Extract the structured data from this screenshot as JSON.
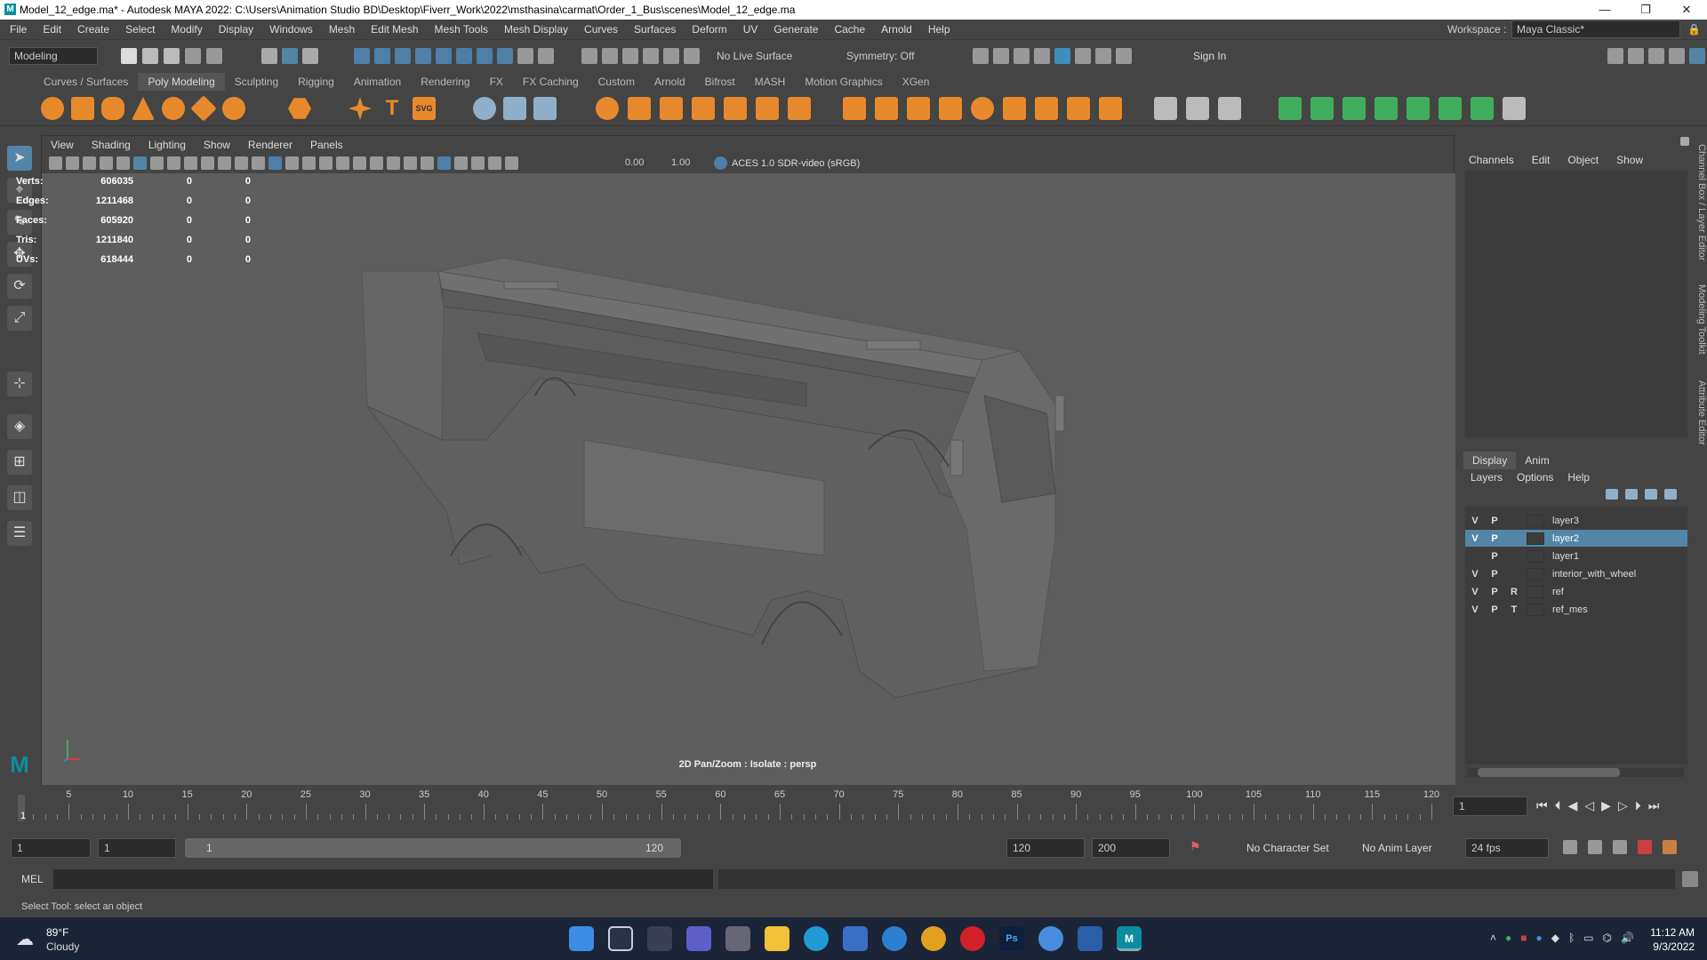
{
  "window": {
    "title": "Model_12_edge.ma* - Autodesk MAYA 2022: C:\\Users\\Animation Studio BD\\Desktop\\Fiverr_Work\\2022\\msthasina\\carmat\\Order_1_Bus\\scenes\\Model_12_edge.ma",
    "minimize": "—",
    "maximize": "❐",
    "close": "✕"
  },
  "menubar": {
    "items": [
      "File",
      "Edit",
      "Create",
      "Select",
      "Modify",
      "Display",
      "Windows",
      "Mesh",
      "Edit Mesh",
      "Mesh Tools",
      "Mesh Display",
      "Curves",
      "Surfaces",
      "Deform",
      "UV",
      "Generate",
      "Cache",
      "Arnold",
      "Help"
    ],
    "workspace_label": "Workspace :",
    "workspace_value": "Maya Classic*"
  },
  "statusline": {
    "menuset": "Modeling",
    "live_surface": "No Live Surface",
    "symmetry": "Symmetry: Off",
    "sign_in": "Sign In"
  },
  "shelf": {
    "tabs": [
      "Curves / Surfaces",
      "Poly Modeling",
      "Sculpting",
      "Rigging",
      "Animation",
      "Rendering",
      "FX",
      "FX Caching",
      "Custom",
      "Arnold",
      "Bifrost",
      "MASH",
      "Motion Graphics",
      "XGen"
    ],
    "active_tab": "Poly Modeling"
  },
  "viewport": {
    "menu": [
      "View",
      "Shading",
      "Lighting",
      "Show",
      "Renderer",
      "Panels"
    ],
    "exposure": "0.00",
    "gamma": "1.00",
    "color_space": "ACES 1.0 SDR-video (sRGB)",
    "hud": {
      "rows": [
        {
          "label": "Verts:",
          "v1": "606035",
          "v2": "0",
          "v3": "0"
        },
        {
          "label": "Edges:",
          "v1": "1211468",
          "v2": "0",
          "v3": "0"
        },
        {
          "label": "Faces:",
          "v1": "605920",
          "v2": "0",
          "v3": "0"
        },
        {
          "label": "Tris:",
          "v1": "1211840",
          "v2": "0",
          "v3": "0"
        },
        {
          "label": "UVs:",
          "v1": "618444",
          "v2": "0",
          "v3": "0"
        }
      ]
    },
    "camera_label": "2D Pan/Zoom : Isolate : persp"
  },
  "channelbox": {
    "menu": [
      "Channels",
      "Edit",
      "Object",
      "Show"
    ]
  },
  "layers": {
    "tabs": [
      "Display",
      "Anim"
    ],
    "active_tab": "Display",
    "menu": [
      "Layers",
      "Options",
      "Help"
    ],
    "rows": [
      {
        "v": "V",
        "p": "P",
        "r": "",
        "name": "layer3",
        "color": "#3c3c3c",
        "selected": false
      },
      {
        "v": "V",
        "p": "P",
        "r": "",
        "name": "layer2",
        "color": "#3c3c3c",
        "selected": true
      },
      {
        "v": "",
        "p": "P",
        "r": "",
        "name": "layer1",
        "color": "#3c3c3c",
        "selected": false
      },
      {
        "v": "V",
        "p": "P",
        "r": "",
        "name": "interior_with_wheel",
        "color": "#3c3c3c",
        "selected": false
      },
      {
        "v": "V",
        "p": "P",
        "r": "R",
        "name": "ref",
        "color": "#3c3c3c",
        "selected": false
      },
      {
        "v": "V",
        "p": "P",
        "r": "T",
        "name": "ref_mes",
        "color": "#3c3c3c",
        "selected": false
      }
    ]
  },
  "sidetabs": [
    "Channel Box / Layer Editor",
    "Modeling Toolkit",
    "Attribute Editor"
  ],
  "timeline": {
    "ticks": [
      "5",
      "10",
      "15",
      "20",
      "25",
      "30",
      "35",
      "40",
      "45",
      "50",
      "55",
      "60",
      "65",
      "70",
      "75",
      "80",
      "85",
      "90",
      "95",
      "100",
      "105",
      "110",
      "115",
      "120"
    ],
    "current_frame_marker": "1",
    "current_frame_field": "1"
  },
  "range": {
    "start": "1",
    "playback_start": "1",
    "slider_start": "1",
    "slider_end": "120",
    "playback_end": "120",
    "end": "200",
    "character_set": "No Character Set",
    "anim_layer": "No Anim Layer",
    "fps": "24 fps"
  },
  "commandline": {
    "label": "MEL"
  },
  "helpline": {
    "text": "Select Tool: select an object"
  },
  "taskbar": {
    "weather_temp": "89°F",
    "weather_desc": "Cloudy",
    "time": "11:12 AM",
    "date": "9/3/2022"
  },
  "colors": {
    "accent": "#5285a6",
    "orange_icon": "#e8892c",
    "green_icon": "#3fae5c"
  }
}
